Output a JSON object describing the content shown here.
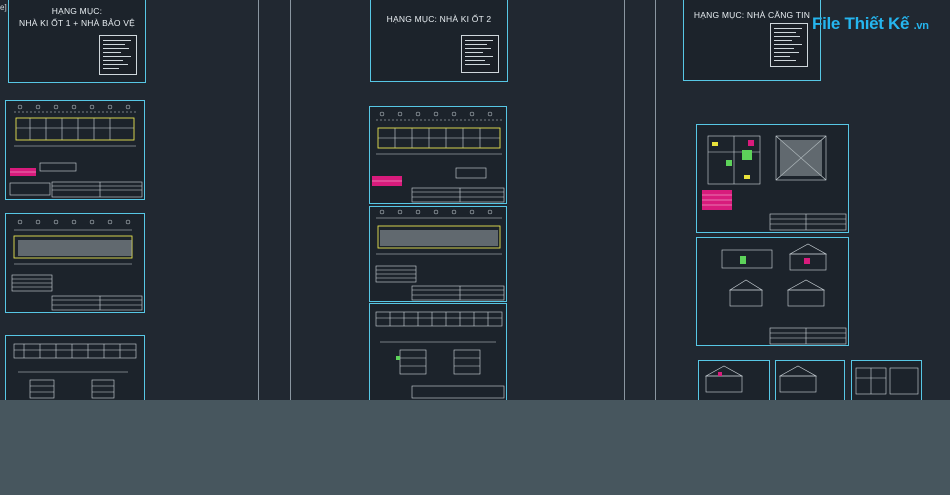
{
  "sheets": {
    "sheet1_title": "HẠNG MỤC:\nNHÀ KI ỐT 1 + NHÀ BẢO VỆ",
    "sheet2_title": "HẠNG MỤC: NHÀ KI ỐT 2",
    "sheet3_title": "HẠNG MỤC: NHÀ CĂNG TIN"
  },
  "watermark": {
    "part1": "File",
    "part2": "Thiết Kế",
    "part3": ".vn"
  },
  "edge_mark": "e]",
  "colors": {
    "background": "#212831",
    "sheet_border": "#57c7e5",
    "magenta": "#d81b7c",
    "green": "#5dd35a",
    "highlight": "#e8e23b",
    "bottom": "#47565e"
  }
}
